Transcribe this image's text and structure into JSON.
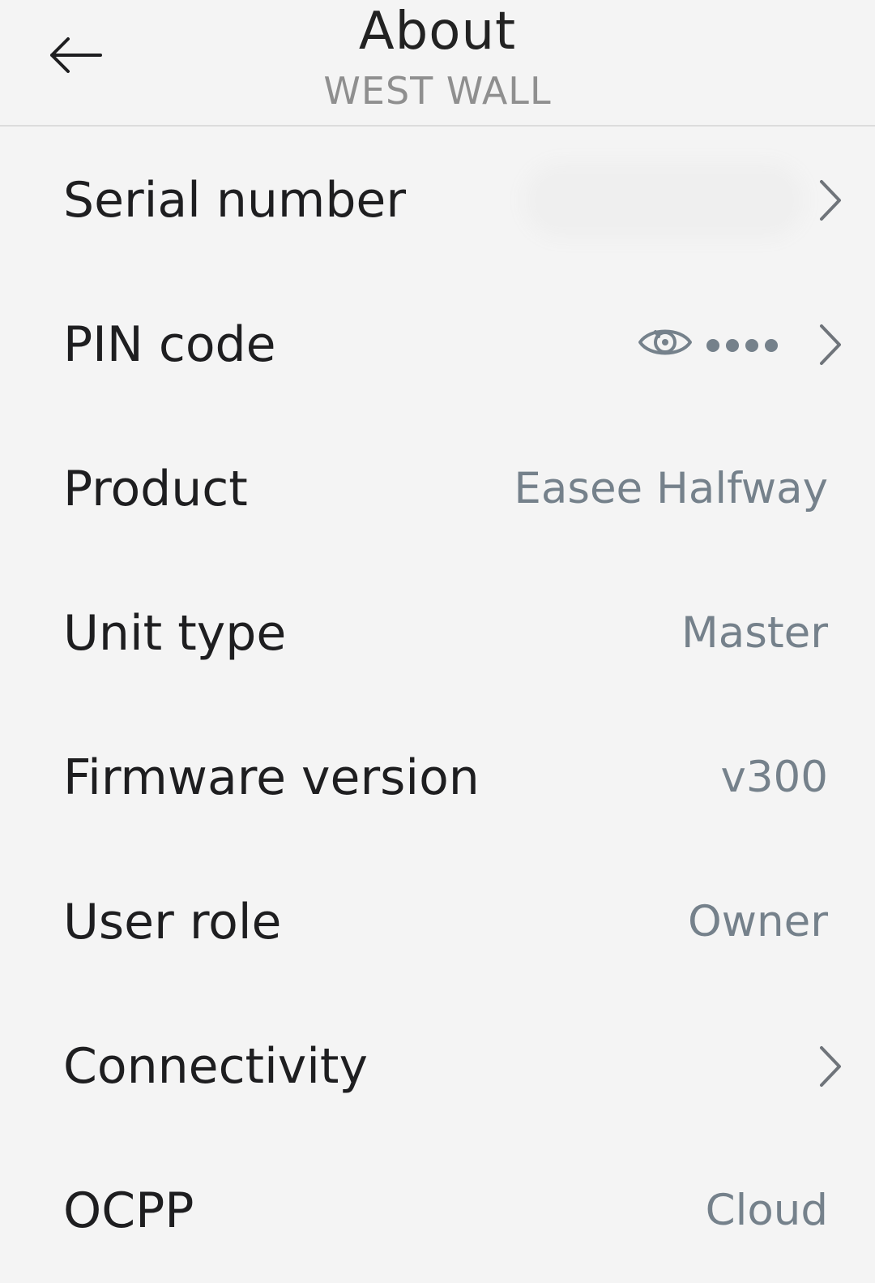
{
  "header": {
    "title": "About",
    "subtitle": "WEST WALL",
    "back_icon": "arrow-left-icon"
  },
  "rows": [
    {
      "label": "Serial number",
      "value": "",
      "has_chevron": true,
      "value_redacted": true
    },
    {
      "label": "PIN code",
      "value": "",
      "has_chevron": true,
      "masked_digits": 4,
      "icon": "eye-icon"
    },
    {
      "label": "Product",
      "value": "Easee Halfway",
      "has_chevron": false
    },
    {
      "label": "Unit type",
      "value": "Master",
      "has_chevron": false
    },
    {
      "label": "Firmware version",
      "value": "v300",
      "has_chevron": false
    },
    {
      "label": "User role",
      "value": "Owner",
      "has_chevron": false
    },
    {
      "label": "Connectivity",
      "value": "",
      "has_chevron": true
    },
    {
      "label": "OCPP",
      "value": "Cloud",
      "has_chevron": false
    }
  ],
  "colors": {
    "background": "#f4f4f4",
    "label_text": "#1e1e20",
    "value_text": "#75818b",
    "subtitle_text": "#8f8f8f",
    "divider": "#dcdcdc"
  }
}
